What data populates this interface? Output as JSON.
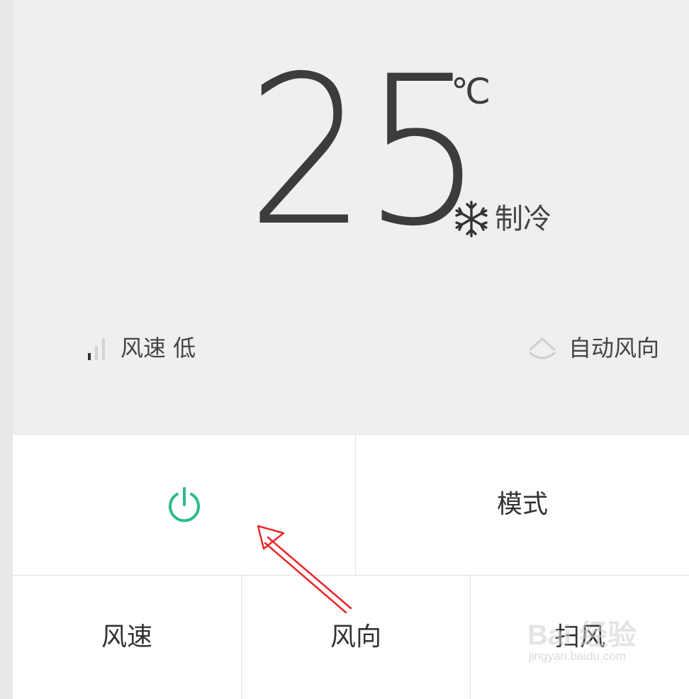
{
  "status": {
    "temperature": "25",
    "unit": "℃",
    "mode": "制冷",
    "fan_speed": "风速 低",
    "air_direction": "自动风向"
  },
  "controls": {
    "mode": "模式",
    "fan_speed": "风速",
    "air_direction": "风向",
    "swing": "扫风"
  },
  "icons": {
    "power": "power-icon",
    "snowflake": "snowflake-icon",
    "signal": "signal-bars-icon",
    "air_direction": "air-direction-icon"
  },
  "colors": {
    "accent": "#2dbb86",
    "annotation_arrow": "#e8262a"
  },
  "watermark": {
    "brand": "Bai 经验",
    "url": "jingyan.baidu.com"
  }
}
